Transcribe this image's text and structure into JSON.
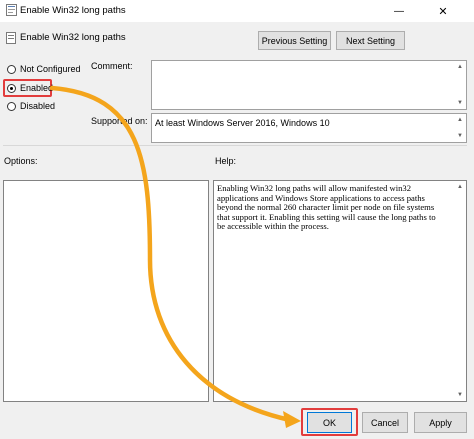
{
  "window": {
    "title": "Enable Win32 long paths",
    "minimize_glyph": "—",
    "close_glyph": "✕"
  },
  "header": {
    "policy_name": "Enable Win32 long paths",
    "previous_setting_label": "Previous Setting",
    "next_setting_label": "Next Setting"
  },
  "state": {
    "options": [
      {
        "label": "Not Configured",
        "selected": false
      },
      {
        "label": "Enabled",
        "selected": true
      },
      {
        "label": "Disabled",
        "selected": false
      }
    ]
  },
  "comment": {
    "label": "Comment:",
    "value": ""
  },
  "supported_on": {
    "label": "Supported on:",
    "value": "At least Windows Server 2016, Windows 10"
  },
  "options_pane": {
    "label": "Options:"
  },
  "help_pane": {
    "label": "Help:",
    "lines": [
      "Enabling Win32 long paths will allow manifested win32",
      "applications and Windows Store applications to access paths",
      "beyond the normal 260 character limit per node on file systems",
      "that support it.  Enabling this setting will cause the long paths to",
      "be accessible within the process."
    ]
  },
  "footer": {
    "ok_label": "OK",
    "cancel_label": "Cancel",
    "apply_label": "Apply"
  },
  "colors": {
    "highlight_box": "#e23d3d",
    "arrow": "#f4a51c",
    "default_button_border": "#0078d7"
  },
  "icons": {
    "app": "policy-document-icon",
    "header": "policy-setting-icon",
    "minimize": "minimize-icon",
    "close": "close-icon",
    "annotation": "annotation-arrow-icon"
  }
}
